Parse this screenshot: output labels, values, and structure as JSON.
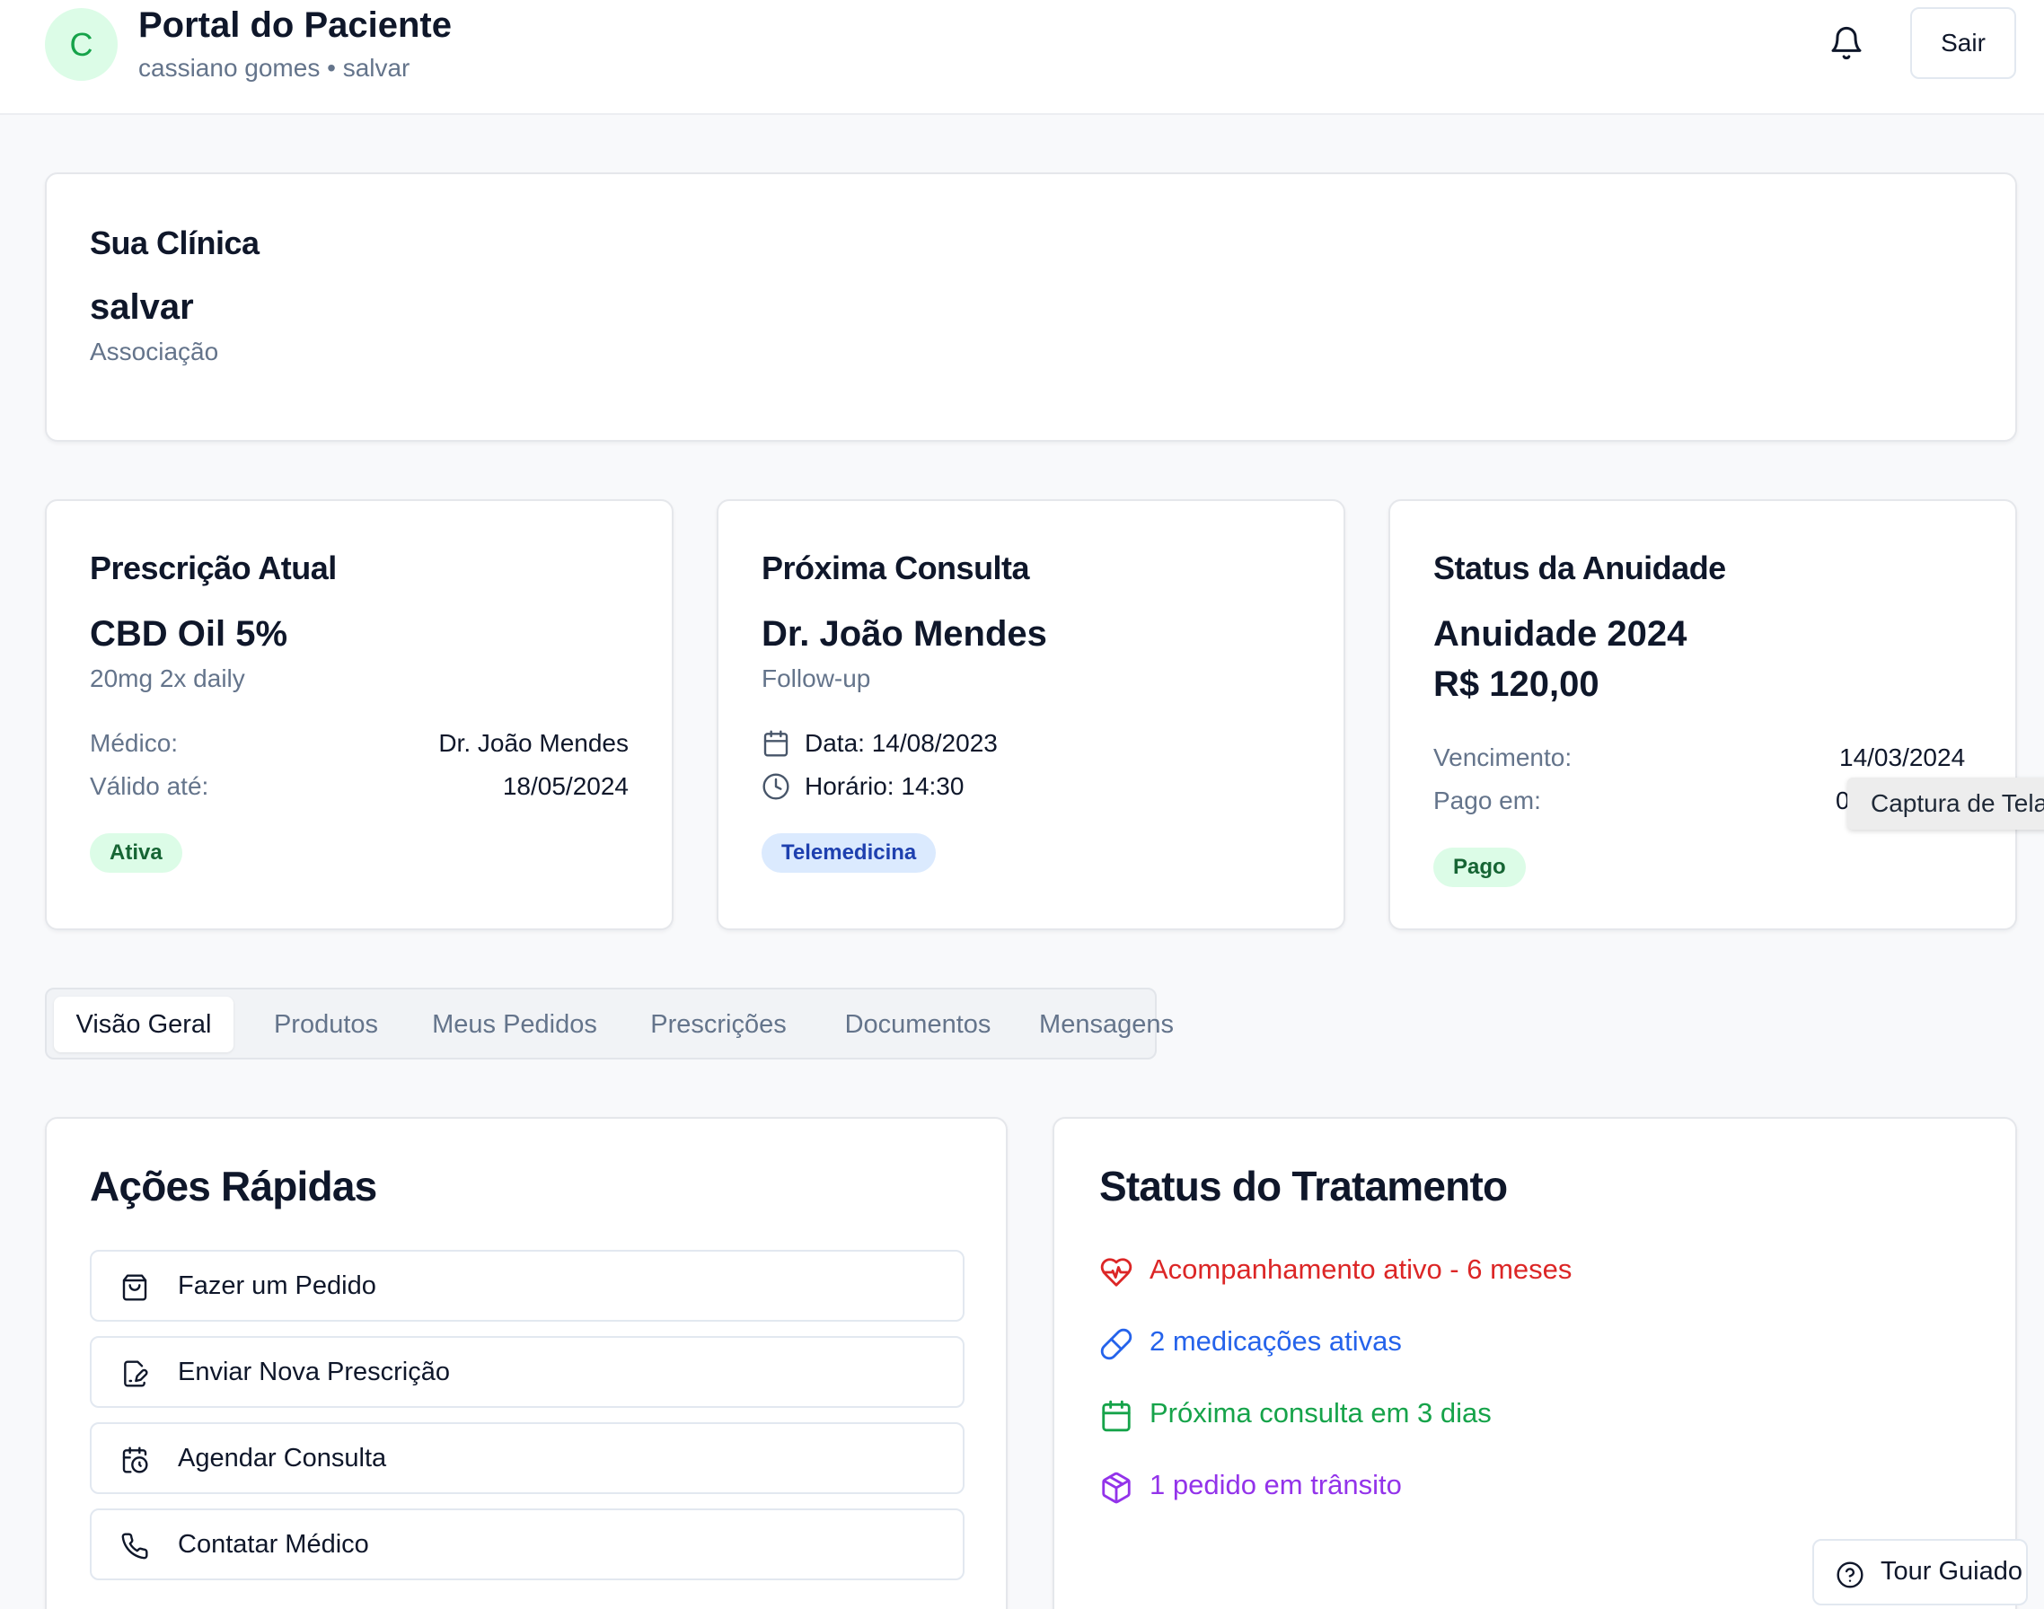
{
  "header": {
    "avatar_initial": "C",
    "title": "Portal do Paciente",
    "subtitle": "cassiano gomes • salvar",
    "logout_label": "Sair"
  },
  "clinic": {
    "heading": "Sua Clínica",
    "name": "salvar",
    "type": "Associação"
  },
  "prescription": {
    "heading": "Prescrição Atual",
    "product": "CBD Oil 5%",
    "dosage": "20mg 2x daily",
    "doctor_label": "Médico:",
    "doctor_value": "Dr. João Mendes",
    "valid_label": "Válido até:",
    "valid_value": "18/05/2024",
    "status": "Ativa"
  },
  "appointment": {
    "heading": "Próxima Consulta",
    "doctor": "Dr. João Mendes",
    "type": "Follow-up",
    "date_text": "Data: 14/08/2023",
    "time_text": "Horário: 14:30",
    "mode": "Telemedicina"
  },
  "annuity": {
    "heading": "Status da Anuidade",
    "title": "Anuidade 2024",
    "amount": "R$ 120,00",
    "due_label": "Vencimento:",
    "due_value": "14/03/2024",
    "paid_label": "Pago em:",
    "paid_value": "0",
    "status": "Pago"
  },
  "tooltip": "Captura de Tela",
  "tabs": [
    {
      "label": "Visão Geral",
      "active": true
    },
    {
      "label": "Produtos",
      "active": false
    },
    {
      "label": "Meus Pedidos",
      "active": false
    },
    {
      "label": "Prescrições",
      "active": false
    },
    {
      "label": "Documentos",
      "active": false
    },
    {
      "label": "Mensagens",
      "active": false
    }
  ],
  "quick_actions": {
    "heading": "Ações Rápidas",
    "items": [
      {
        "label": "Fazer um Pedido",
        "icon": "shopping-bag-icon"
      },
      {
        "label": "Enviar Nova Prescrição",
        "icon": "file-signature-icon"
      },
      {
        "label": "Agendar Consulta",
        "icon": "calendar-clock-icon"
      },
      {
        "label": "Contatar Médico",
        "icon": "phone-icon"
      }
    ]
  },
  "treatment": {
    "heading": "Status do Tratamento",
    "items": [
      {
        "text": "Acompanhamento ativo - 6 meses",
        "icon": "heart-pulse-icon",
        "color": "#dc2626"
      },
      {
        "text": "2 medicações ativas",
        "icon": "pill-icon",
        "color": "#2563eb"
      },
      {
        "text": "Próxima consulta em 3 dias",
        "icon": "calendar-icon",
        "color": "#16a34a"
      },
      {
        "text": "1 pedido em trânsito",
        "icon": "package-icon",
        "color": "#9333ea"
      }
    ]
  },
  "tour_label": "Tour Guiado"
}
